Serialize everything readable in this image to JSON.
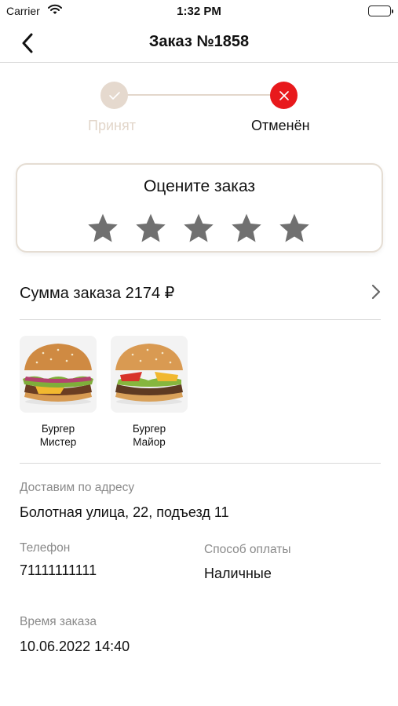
{
  "status_bar": {
    "carrier": "Carrier",
    "time": "1:32 PM"
  },
  "nav": {
    "title": "Заказ №1858"
  },
  "stepper": {
    "steps": [
      {
        "label": "Принят",
        "state": "done"
      },
      {
        "label": "Отменён",
        "state": "cancelled"
      }
    ],
    "colors": {
      "done": "#e5d9ce",
      "cancelled": "#e8191c"
    }
  },
  "rating": {
    "title": "Оцените заказ",
    "stars": 5,
    "selected": 0
  },
  "order_sum": {
    "label": "Сумма заказа 2174 ₽"
  },
  "items": [
    {
      "name": "Бургер\nМистер",
      "image": "burger-mister"
    },
    {
      "name": "Бургер\nМайор",
      "image": "burger-mayor"
    }
  ],
  "delivery": {
    "label": "Доставим по адресу",
    "value": "Болотная улица, 22, подъезд 11"
  },
  "phone": {
    "label": "Телефон",
    "value": "71111111111"
  },
  "payment": {
    "label": "Способ оплаты",
    "value": "Наличные"
  },
  "order_time": {
    "label": "Время заказа",
    "value": "10.06.2022 14:40"
  }
}
